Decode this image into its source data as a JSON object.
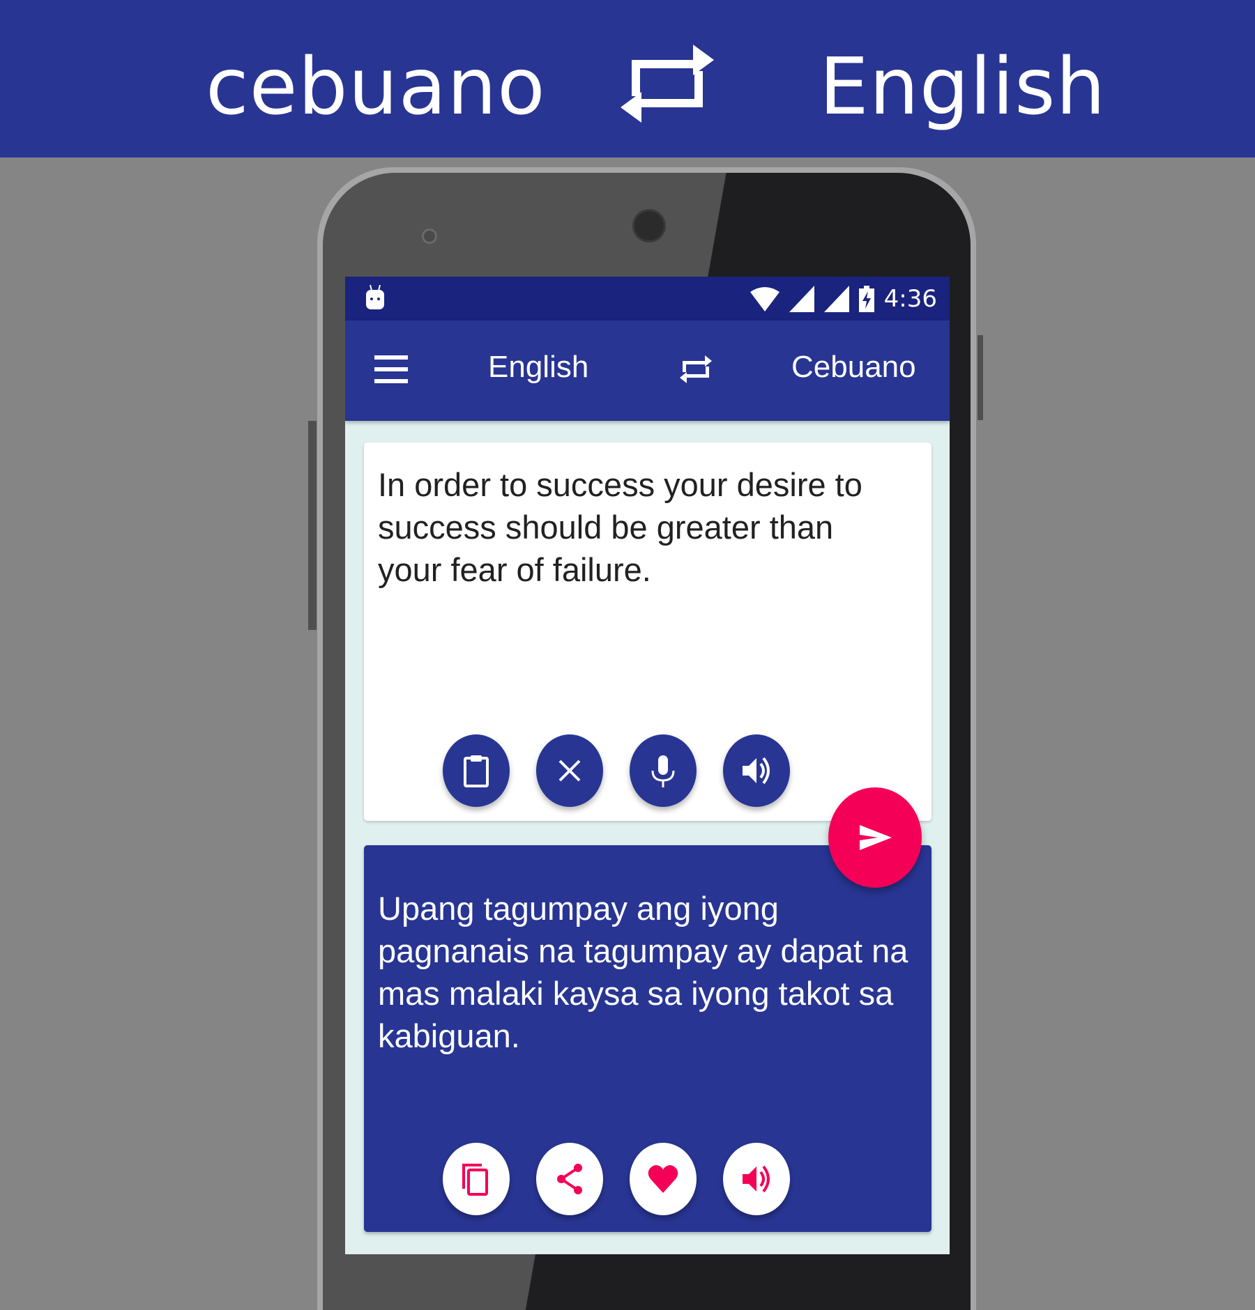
{
  "banner": {
    "source_language": "cebuano",
    "target_language": "English",
    "swap_icon": "swap-arrows-icon"
  },
  "status_bar": {
    "time": "4:36",
    "icons": [
      "android-notification-icon",
      "wifi-icon",
      "signal-icon",
      "signal-icon",
      "battery-charging-icon"
    ]
  },
  "toolbar": {
    "menu_icon": "hamburger-menu-icon",
    "source_language": "English",
    "swap_icon": "swap-arrows-icon",
    "target_language": "Cebuano"
  },
  "input_card": {
    "text": "In order to success your desire to success should be greater than your fear of failure.",
    "buttons": [
      {
        "name": "paste",
        "icon": "clipboard-icon"
      },
      {
        "name": "clear",
        "icon": "close-icon"
      },
      {
        "name": "voice-input",
        "icon": "microphone-icon"
      },
      {
        "name": "speak",
        "icon": "speaker-icon"
      }
    ]
  },
  "translate_button": {
    "icon": "send-icon"
  },
  "output_card": {
    "text": "Upang tagumpay ang iyong pagnanais na tagumpay ay dapat na mas malaki kaysa sa iyong takot sa kabiguan.",
    "buttons": [
      {
        "name": "copy",
        "icon": "copy-icon"
      },
      {
        "name": "share",
        "icon": "share-icon"
      },
      {
        "name": "favorite",
        "icon": "heart-icon"
      },
      {
        "name": "speak",
        "icon": "speaker-icon"
      }
    ]
  },
  "colors": {
    "primary": "#283593",
    "primary_dark": "#1A237E",
    "accent": "#F50057",
    "content_background": "#DFF0EE",
    "page_background": "#858585"
  }
}
